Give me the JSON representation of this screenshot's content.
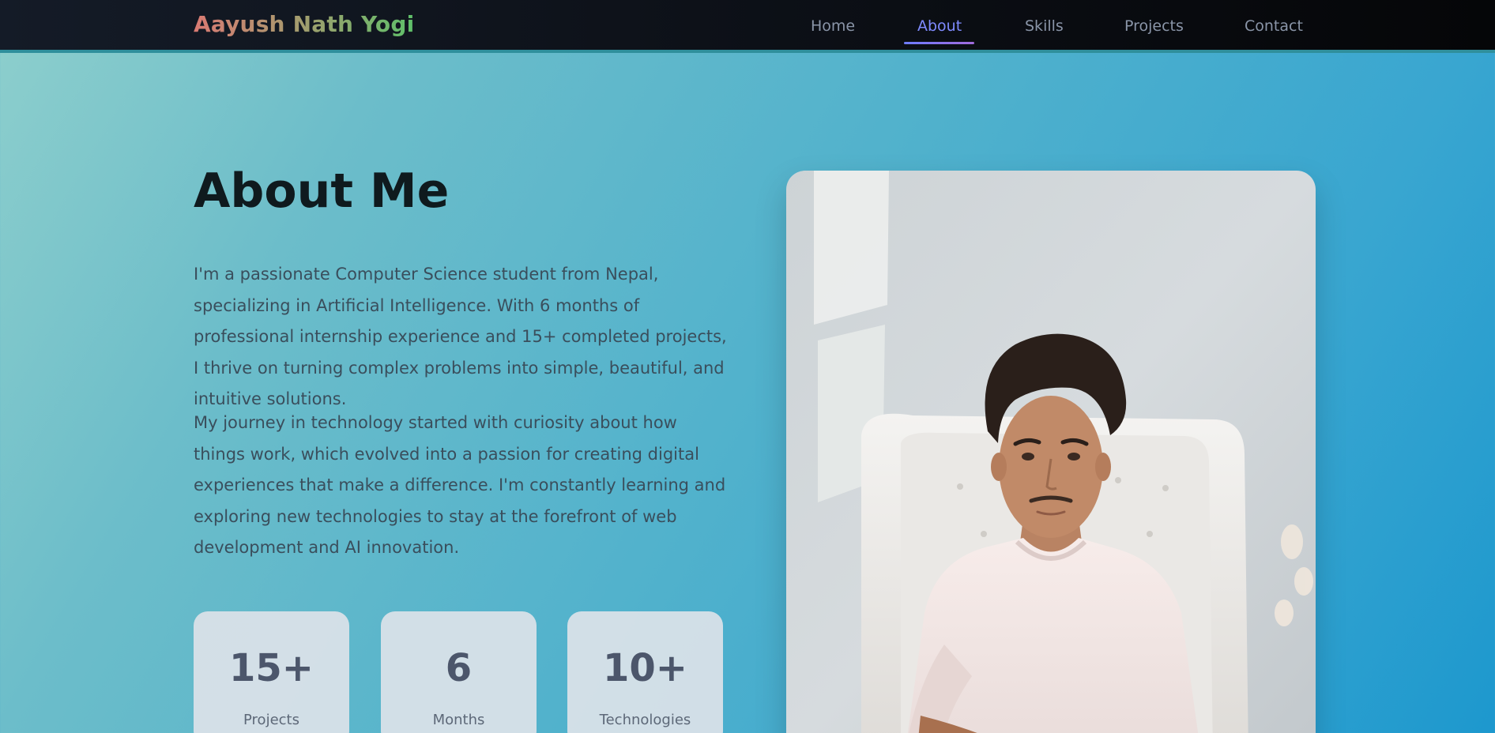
{
  "brand": {
    "name": "Aayush Nath Yogi"
  },
  "nav": {
    "items": [
      {
        "label": "Home"
      },
      {
        "label": "About"
      },
      {
        "label": "Skills"
      },
      {
        "label": "Projects"
      },
      {
        "label": "Contact"
      }
    ],
    "active": "About"
  },
  "about": {
    "title": "About Me",
    "paragraphs": [
      "I'm a passionate Computer Science student from Nepal, specializing in Artificial Intelligence. With 6 months of professional internship experience and 15+ completed projects, I thrive on turning complex problems into simple, beautiful, and intuitive solutions.",
      "My journey in technology started with curiosity about how things work, which evolved into a passion for creating digital experiences that make a difference. I'm constantly learning and exploring new technologies to stay at the forefront of web development and AI innovation."
    ]
  },
  "stats": [
    {
      "value": "15+",
      "label": "Projects"
    },
    {
      "value": "6",
      "label": "Months"
    },
    {
      "value": "10+",
      "label": "Technologies"
    }
  ],
  "colors": {
    "accent": "#7f8bff",
    "heading": "#0f1a1e",
    "body_text": "#3a4e5c"
  }
}
